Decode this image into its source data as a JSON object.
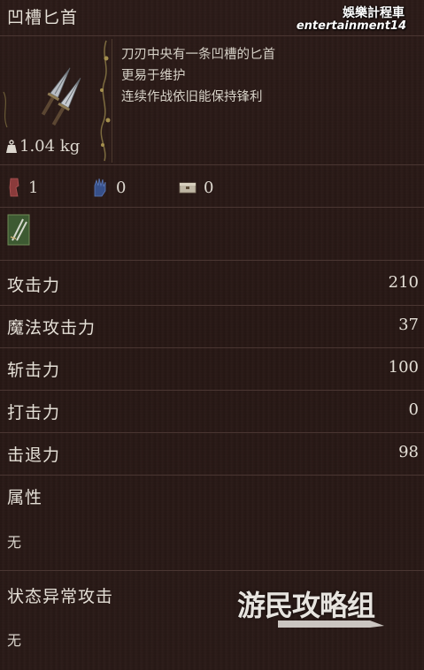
{
  "item": {
    "name": "凹槽匕首",
    "description_lines": [
      "刀刃中央有一条凹槽的匕首",
      "更易于维护",
      "连续作战依旧能保持锋利"
    ],
    "weight": "1.04 kg"
  },
  "watermark": {
    "line1": "娛樂計程車",
    "line2": "entertainment14"
  },
  "requirements": [
    {
      "icon": "strength-icon",
      "value": "1"
    },
    {
      "icon": "dexterity-icon",
      "value": "0"
    },
    {
      "icon": "chest-icon",
      "value": "0"
    }
  ],
  "weapon_class_icon": "dagger-class-icon",
  "stats": [
    {
      "label": "攻击力",
      "value": "210"
    },
    {
      "label": "魔法攻击力",
      "value": "37"
    },
    {
      "label": "斩击力",
      "value": "100"
    },
    {
      "label": "打击力",
      "value": "0"
    },
    {
      "label": "击退力",
      "value": "98"
    }
  ],
  "attribute": {
    "label": "属性",
    "value": "无"
  },
  "status_attack": {
    "label": "状态异常攻击",
    "value": "无"
  },
  "site_watermark": "游民攻略组",
  "colors": {
    "background": "#2a1a17",
    "text": "#e4dfd6",
    "divider": "#4a3632",
    "vine": "#8a7a4a"
  }
}
